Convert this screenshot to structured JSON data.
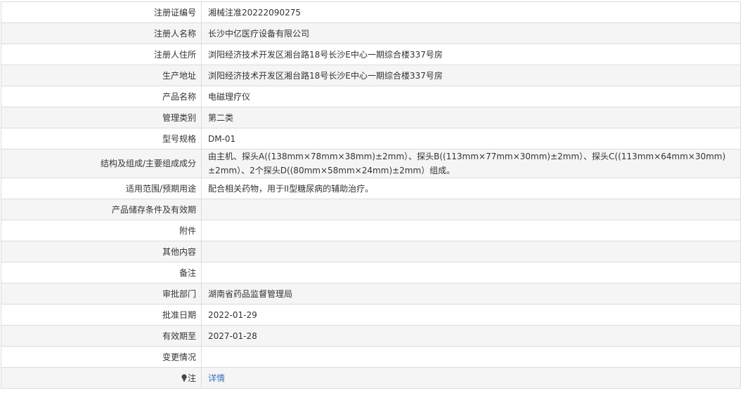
{
  "rows": [
    {
      "label": "注册证编号",
      "value": "湘械注准20222090275"
    },
    {
      "label": "注册人名称",
      "value": "长沙中亿医疗设备有限公司"
    },
    {
      "label": "注册人住所",
      "value": "浏阳经济技术开发区湘台路18号长沙E中心一期综合楼337号房"
    },
    {
      "label": "生产地址",
      "value": "浏阳经济技术开发区湘台路18号长沙E中心一期综合楼337号房"
    },
    {
      "label": "产品名称",
      "value": "电磁理疗仪"
    },
    {
      "label": "管理类别",
      "value": "第二类"
    },
    {
      "label": "型号规格",
      "value": "DM-01"
    },
    {
      "label": "结构及组成/主要组成成分",
      "value": "由主机、探头A((138mm×78mm×38mm)±2mm）、探头B((113mm×77mm×30mm)±2mm）、探头C((113mm×64mm×30mm)±2mm）、2个探头D((80mm×58mm×24mm)±2mm）组成。"
    },
    {
      "label": "适用范围/预期用途",
      "value": "配合相关药物，用于II型糖尿病的辅助治疗。"
    },
    {
      "label": "产品储存条件及有效期",
      "value": ""
    },
    {
      "label": "附件",
      "value": ""
    },
    {
      "label": "其他内容",
      "value": ""
    },
    {
      "label": "备注",
      "value": ""
    },
    {
      "label": "审批部门",
      "value": "湖南省药品监督管理局"
    },
    {
      "label": "批准日期",
      "value": "2022-01-29"
    },
    {
      "label": "有效期至",
      "value": "2027-01-28"
    },
    {
      "label": "变更情况",
      "value": ""
    }
  ],
  "note": {
    "label": "注",
    "icon": "lightbulb-icon",
    "link_text": "详情"
  },
  "colors": {
    "border": "#dcdcdc",
    "row_alt": "#f5f5f5",
    "link": "#3b6fb6",
    "text": "#333333"
  }
}
